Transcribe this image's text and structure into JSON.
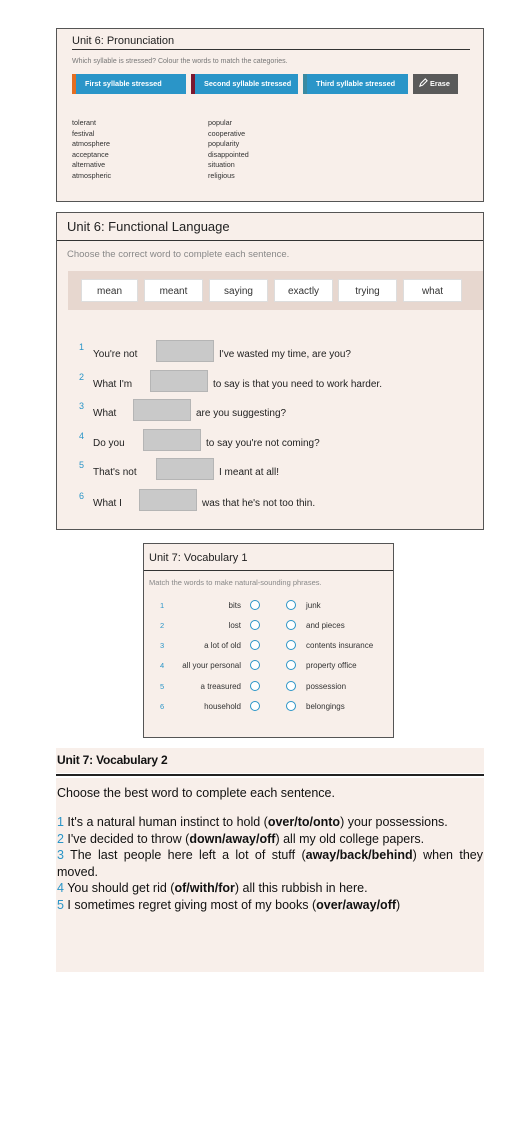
{
  "pron": {
    "title": "Unit 6: Pronunciation",
    "instruction": "Which syllable is stressed? Colour the words to match the categories.",
    "categories": [
      "First syllable stressed",
      "Second syllable stressed",
      "Third syllable stressed"
    ],
    "erase_label": "Erase",
    "erase_icon": "pencil-icon",
    "left_words": [
      "tolerant",
      "festival",
      "atmosphere",
      "acceptance",
      "alternative",
      "atmospheric"
    ],
    "right_words": [
      "popular",
      "cooperative",
      "popularity",
      "disappointed",
      "situation",
      "religious"
    ],
    "colors": {
      "button": "#2a95c8",
      "cat1": "#e46e22",
      "cat2": "#7a1830",
      "cat3": "#3a8aa1",
      "erase": "#5a5a5a"
    }
  },
  "func": {
    "title": "Unit 6: Functional Language",
    "instruction": "Choose the correct word to complete each sentence.",
    "bank": [
      "mean",
      "meant",
      "saying",
      "exactly",
      "trying",
      "what"
    ],
    "questions": [
      {
        "num": "1",
        "pre": "You're not",
        "post": "I've wasted my time, are you?"
      },
      {
        "num": "2",
        "pre": "What I'm",
        "post": "to say is that you need to work harder."
      },
      {
        "num": "3",
        "pre": "What",
        "post": "are you suggesting?"
      },
      {
        "num": "4",
        "pre": "Do you",
        "post": "to say you're not coming?"
      },
      {
        "num": "5",
        "pre": "That's not",
        "post": "I meant at all!"
      },
      {
        "num": "6",
        "pre": "What I",
        "post": "was that he's not too thin."
      }
    ]
  },
  "vocab1": {
    "title": "Unit 7: Vocabulary 1",
    "instruction": "Match the words to make natural-sounding phrases.",
    "rows": [
      {
        "num": "1",
        "left": "bits",
        "right": "junk"
      },
      {
        "num": "2",
        "left": "lost",
        "right": "and pieces"
      },
      {
        "num": "3",
        "left": "a lot of old",
        "right": "contents insurance"
      },
      {
        "num": "4",
        "left": "all your personal",
        "right": "property office"
      },
      {
        "num": "5",
        "left": "a treasured",
        "right": "possession"
      },
      {
        "num": "6",
        "left": "household",
        "right": "belongings"
      }
    ]
  },
  "vocab2": {
    "title": "Unit 7: Vocabulary 2",
    "instruction": "Choose the best word to complete each sentence.",
    "items": [
      {
        "num": "1",
        "pre": " It's a natural human instinct to hold (",
        "opts": "over/to/onto",
        "post": ") your possessions."
      },
      {
        "num": "2",
        "pre": " I've decided to throw (",
        "opts": "down/away/off",
        "post": ") all my old college papers."
      },
      {
        "num": "3",
        "pre": " The last people here left a lot of stuff (",
        "opts": "away/back/behind",
        "post": ") when they moved."
      },
      {
        "num": "4",
        "pre": " You should get rid (",
        "opts": "of/with/for",
        "post": ") all this rubbish in here."
      },
      {
        "num": "5",
        "pre": " I sometimes regret giving most of my books (",
        "opts": "over/away/off",
        "post": ")"
      }
    ]
  }
}
